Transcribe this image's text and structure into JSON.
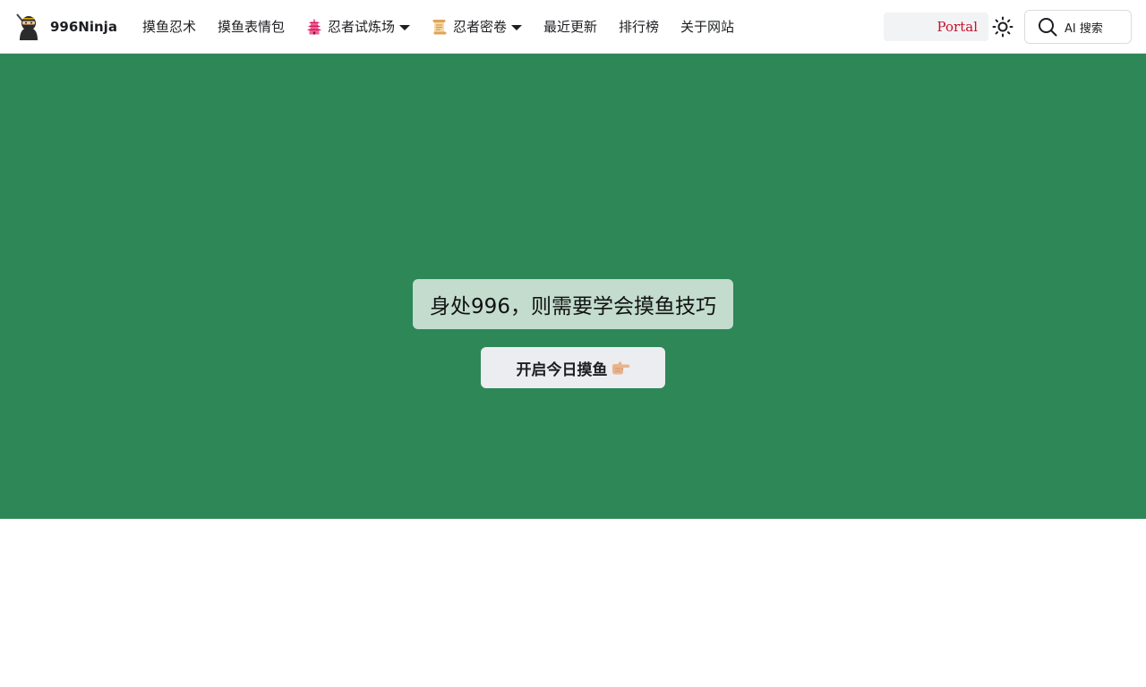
{
  "brand": {
    "title": "996Ninja",
    "logo_icon": "ninja-icon"
  },
  "nav": {
    "items": [
      {
        "label": "摸鱼忍术"
      },
      {
        "label": "摸鱼表情包"
      },
      {
        "label": "忍者试炼场",
        "icon": "pagoda-icon",
        "dropdown": true
      },
      {
        "label": "忍者密卷",
        "icon": "scroll-icon",
        "dropdown": true
      },
      {
        "label": "最近更新"
      },
      {
        "label": "排行榜"
      },
      {
        "label": "关于网站"
      }
    ]
  },
  "right": {
    "portal_label": "Portal",
    "theme_icon": "sun-icon",
    "search_label": "AI 搜索",
    "search_icon": "search-icon"
  },
  "hero": {
    "tagline": "身处996，则需要学会摸鱼技巧",
    "cta_label": "开启今日摸鱼",
    "cta_icon": "pointing-hand-icon",
    "background": "#2e8757"
  },
  "colors": {
    "accent": "#2e8757",
    "portal": "#c8102e"
  }
}
